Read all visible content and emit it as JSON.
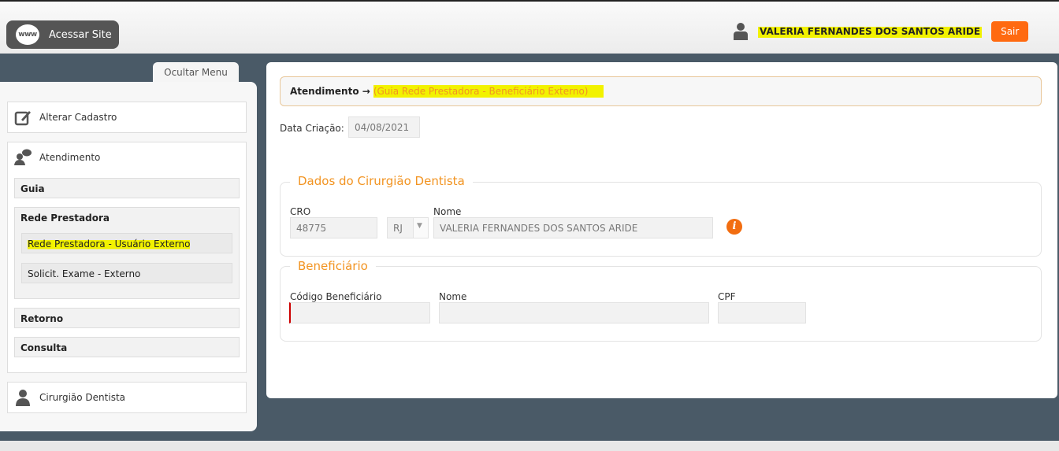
{
  "header": {
    "site_button": "Acessar Site",
    "www_label": "www",
    "user_name": "VALERIA FERNANDES DOS SANTOS ARIDE",
    "logout": "Sair"
  },
  "sidebar": {
    "toggle": "Ocultar Menu",
    "alterar": "Alterar Cadastro",
    "atendimento": "Atendimento",
    "guia": "Guia",
    "rede": "Rede Prestadora",
    "rede_externo": "Rede Prestadora - Usuário Externo",
    "solicit": "Solicit. Exame - Externo",
    "retorno": "Retorno",
    "consulta": "Consulta",
    "cirurgiao": "Cirurgião Dentista"
  },
  "main": {
    "crumb_root": "Atendimento →",
    "crumb_current": "(Guia Rede Prestadora - Beneficiário Externo)",
    "data_criacao_label": "Data Criação:",
    "data_criacao": "04/08/2021",
    "dentista": {
      "legend": "Dados do Cirurgião Dentista",
      "cro_label": "CRO",
      "cro": "48775",
      "uf": "RJ",
      "nome_label": "Nome",
      "nome": "VALERIA FERNANDES DOS SANTOS ARIDE",
      "info": "i"
    },
    "beneficiario": {
      "legend": "Beneficiário",
      "codigo_label": "Código Beneficiário",
      "codigo": "",
      "nome_label": "Nome",
      "nome": "",
      "cpf_label": "CPF",
      "cpf": ""
    }
  },
  "colors": {
    "accent": "#ff6a10",
    "legend": "#f29422",
    "bg": "#4a5a67"
  }
}
